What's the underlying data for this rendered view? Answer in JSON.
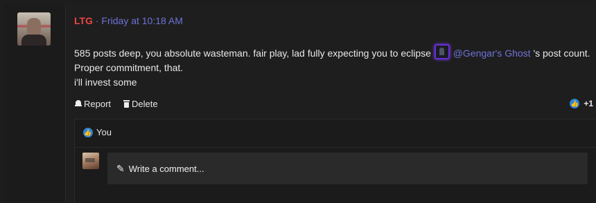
{
  "post": {
    "username": "LTG",
    "separator": "·",
    "timestamp": "Friday at 10:18 AM",
    "content": {
      "line1_before": "585 posts deep, you absolute wasteman. fair play, lad fully expecting you to eclipse",
      "mention": "@Gengar's Ghost",
      "line1_after": "'s post count. Proper commitment, that.",
      "line2": "i'll invest some"
    },
    "actions": {
      "report_label": "Report",
      "delete_label": "Delete"
    },
    "likes": {
      "count_label": "+1"
    },
    "reactions": {
      "reacted_by": "You"
    },
    "comment": {
      "placeholder": "Write a comment..."
    }
  },
  "colors": {
    "username": "#f04444",
    "link": "#6f73d8",
    "like_blue": "#2d86d8",
    "background": "#1d1d1d"
  },
  "icons": [
    "bell-icon",
    "trash-icon",
    "thumbs-up-icon",
    "pencil-icon"
  ]
}
